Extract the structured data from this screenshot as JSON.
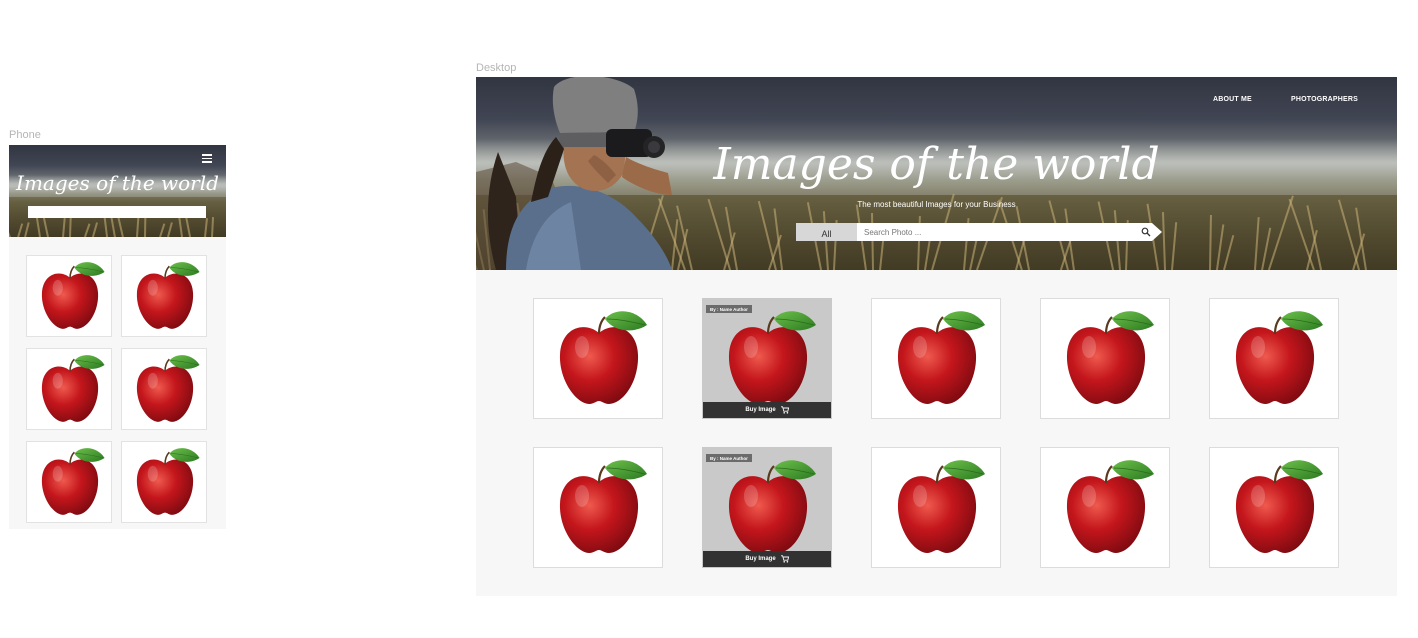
{
  "frames": {
    "phone_label": "Phone",
    "desktop_label": "Desktop"
  },
  "phone": {
    "title": "Images of the world",
    "menu_icon": "hamburger-menu-icon",
    "search_placeholder": "",
    "image_count": 6
  },
  "desktop": {
    "nav": [
      "ABOUT ME",
      "PHOTOGRAPHERS"
    ],
    "title": "Images of the world",
    "subtitle": "The most beautiful Images for your Business",
    "search": {
      "category": "All",
      "placeholder": "Search Photo ...",
      "icon": "search-icon"
    },
    "gallery": [
      {
        "type": "plain"
      },
      {
        "type": "hover",
        "author": "By : Name Author",
        "buy_label": "Buy Image",
        "buy_icon": "cart-icon"
      },
      {
        "type": "plain"
      },
      {
        "type": "plain"
      },
      {
        "type": "plain"
      },
      {
        "type": "plain"
      },
      {
        "type": "hover",
        "author": "By : Name Author",
        "buy_label": "Buy Image",
        "buy_icon": "cart-icon"
      },
      {
        "type": "plain"
      },
      {
        "type": "plain"
      },
      {
        "type": "plain"
      }
    ]
  },
  "colors": {
    "apple_red": "#c4161c",
    "leaf_green": "#3f9a2e",
    "hero_sky": "#3c4150",
    "buy_bar": "#323232"
  }
}
